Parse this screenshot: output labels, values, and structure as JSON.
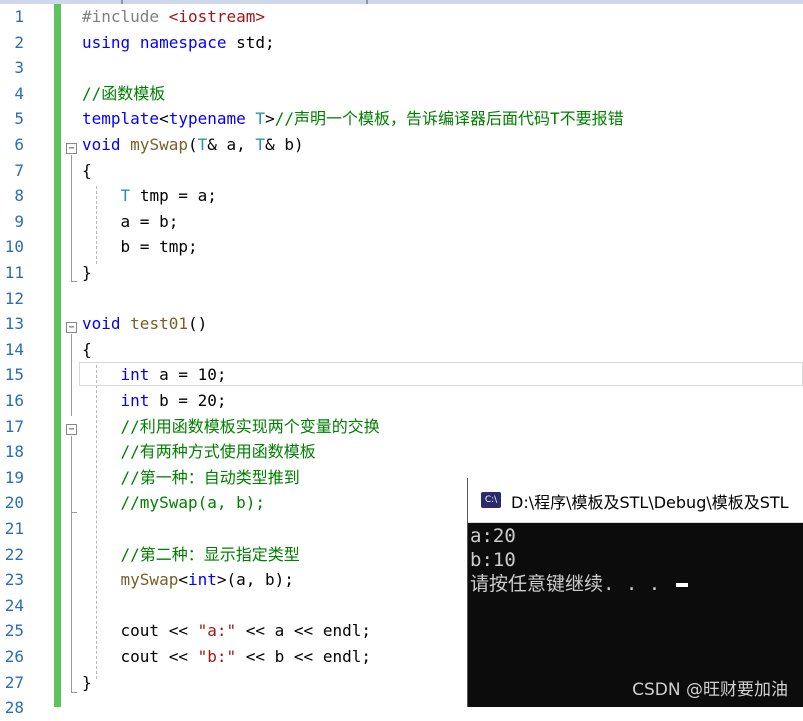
{
  "editor": {
    "lines": [
      {
        "n": "1",
        "parts": [
          [
            "pp",
            "#include "
          ],
          [
            "str",
            "<iostream>"
          ]
        ]
      },
      {
        "n": "2",
        "parts": [
          [
            "kw",
            "using"
          ],
          [
            "cn",
            " "
          ],
          [
            "kw",
            "namespace"
          ],
          [
            "cn",
            " std;"
          ]
        ]
      },
      {
        "n": "3",
        "parts": []
      },
      {
        "n": "4",
        "parts": [
          [
            "cm",
            "//函数模板"
          ]
        ]
      },
      {
        "n": "5",
        "parts": [
          [
            "kw",
            "template"
          ],
          [
            "cn",
            "<"
          ],
          [
            "kw",
            "typename"
          ],
          [
            "cn",
            " "
          ],
          [
            "ty",
            "T"
          ],
          [
            "cn",
            ">"
          ],
          [
            "cm",
            "//声明一个模板，告诉编译器后面代码T不要报错"
          ]
        ]
      },
      {
        "n": "6",
        "parts": [
          [
            "kw",
            "void"
          ],
          [
            "cn",
            " "
          ],
          [
            "fn",
            "mySwap"
          ],
          [
            "cn",
            "("
          ],
          [
            "ty",
            "T"
          ],
          [
            "cn",
            "& "
          ],
          [
            "cn",
            "a"
          ],
          [
            "cn",
            ", "
          ],
          [
            "ty",
            "T"
          ],
          [
            "cn",
            "& "
          ],
          [
            "cn",
            "b"
          ],
          [
            "cn",
            ")"
          ]
        ]
      },
      {
        "n": "7",
        "parts": [
          [
            "cn",
            "{"
          ]
        ]
      },
      {
        "n": "8",
        "parts": [
          [
            "cn",
            "    "
          ],
          [
            "ty",
            "T"
          ],
          [
            "cn",
            " "
          ],
          [
            "cn",
            "tmp"
          ],
          [
            "cn",
            " = "
          ],
          [
            "cn",
            "a"
          ],
          [
            "cn",
            ";"
          ]
        ]
      },
      {
        "n": "9",
        "parts": [
          [
            "cn",
            "    "
          ],
          [
            "cn",
            "a"
          ],
          [
            "cn",
            " = "
          ],
          [
            "cn",
            "b"
          ],
          [
            "cn",
            ";"
          ]
        ]
      },
      {
        "n": "10",
        "parts": [
          [
            "cn",
            "    "
          ],
          [
            "cn",
            "b"
          ],
          [
            "cn",
            " = "
          ],
          [
            "cn",
            "tmp"
          ],
          [
            "cn",
            ";"
          ]
        ]
      },
      {
        "n": "11",
        "parts": [
          [
            "cn",
            "}"
          ]
        ]
      },
      {
        "n": "12",
        "parts": []
      },
      {
        "n": "13",
        "parts": [
          [
            "kw",
            "void"
          ],
          [
            "cn",
            " "
          ],
          [
            "fn",
            "test01"
          ],
          [
            "cn",
            "()"
          ]
        ]
      },
      {
        "n": "14",
        "parts": [
          [
            "cn",
            "{"
          ]
        ]
      },
      {
        "n": "15",
        "parts": [
          [
            "cn",
            "    "
          ],
          [
            "kw",
            "int"
          ],
          [
            "cn",
            " a = 10;"
          ]
        ]
      },
      {
        "n": "16",
        "parts": [
          [
            "cn",
            "    "
          ],
          [
            "kw",
            "int"
          ],
          [
            "cn",
            " b = 20;"
          ]
        ]
      },
      {
        "n": "17",
        "parts": [
          [
            "cn",
            "    "
          ],
          [
            "cm",
            "//利用函数模板实现两个变量的交换"
          ]
        ]
      },
      {
        "n": "18",
        "parts": [
          [
            "cn",
            "    "
          ],
          [
            "cm",
            "//有两种方式使用函数模板"
          ]
        ]
      },
      {
        "n": "19",
        "parts": [
          [
            "cn",
            "    "
          ],
          [
            "cm",
            "//第一种：自动类型推到"
          ]
        ]
      },
      {
        "n": "20",
        "parts": [
          [
            "cn",
            "    "
          ],
          [
            "cm",
            "//mySwap(a, b);"
          ]
        ]
      },
      {
        "n": "21",
        "parts": []
      },
      {
        "n": "22",
        "parts": [
          [
            "cn",
            "    "
          ],
          [
            "cm",
            "//第二种：显示指定类型"
          ]
        ]
      },
      {
        "n": "23",
        "parts": [
          [
            "cn",
            "    "
          ],
          [
            "fn",
            "mySwap"
          ],
          [
            "cn",
            "<"
          ],
          [
            "kw",
            "int"
          ],
          [
            "cn",
            ">(a, b);"
          ]
        ]
      },
      {
        "n": "24",
        "parts": []
      },
      {
        "n": "25",
        "parts": [
          [
            "cn",
            "    cout << "
          ],
          [
            "str",
            "\"a:\""
          ],
          [
            "cn",
            " << a << endl;"
          ]
        ]
      },
      {
        "n": "26",
        "parts": [
          [
            "cn",
            "    cout << "
          ],
          [
            "str",
            "\"b:\""
          ],
          [
            "cn",
            " << b << endl;"
          ]
        ]
      },
      {
        "n": "27",
        "parts": [
          [
            "cn",
            "}"
          ]
        ]
      },
      {
        "n": "28",
        "parts": []
      }
    ]
  },
  "console": {
    "icon_text": "C:\\",
    "title": "D:\\程序\\模板及STL\\Debug\\模板及STL",
    "output_line1": "a:20",
    "output_line2": "b:10",
    "output_line3": "请按任意键继续. . . ",
    "watermark": "CSDN @旺财要加油"
  },
  "colors": {
    "keyword": "#0000ff",
    "comment": "#008000",
    "string": "#a31515",
    "type": "#2b91af",
    "function": "#795e26",
    "line_number": "#2b6fb3",
    "change_bar": "#5ec25e",
    "console_bg": "#0c0c0c"
  }
}
